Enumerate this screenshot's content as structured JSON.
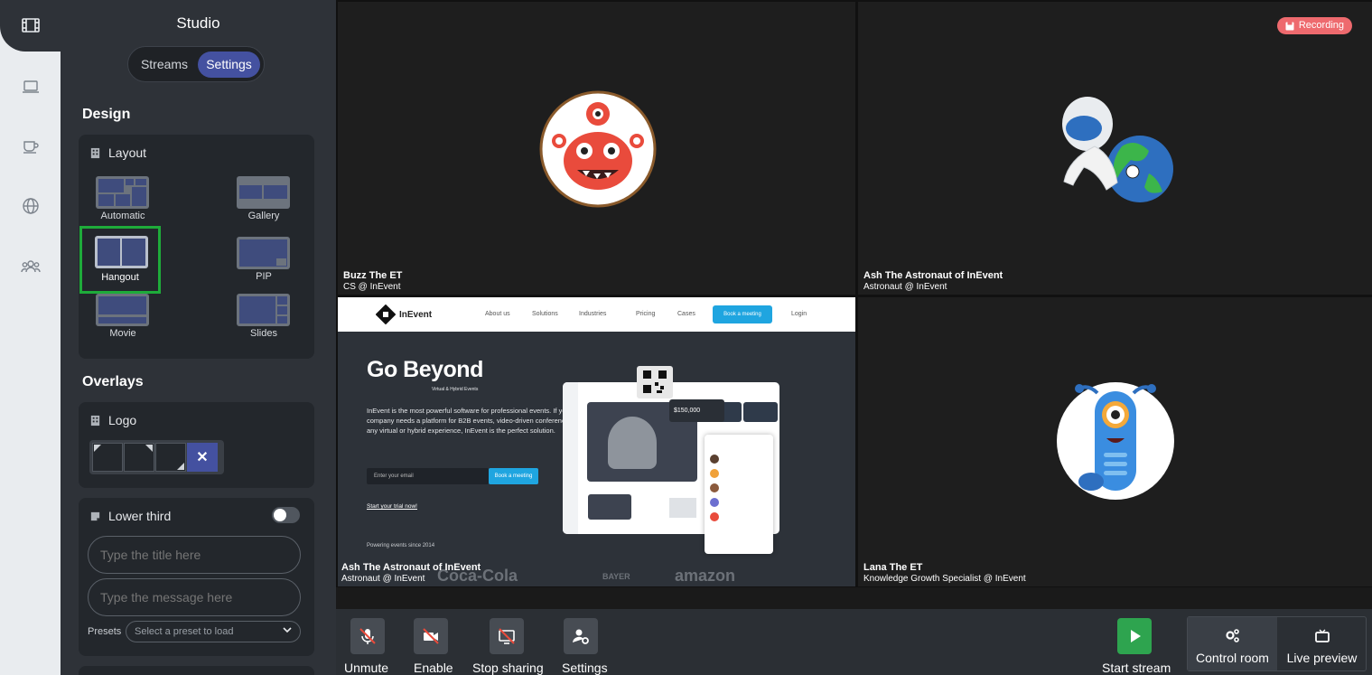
{
  "rail": {
    "items": [
      "studio-icon",
      "laptop-icon",
      "coffee-icon",
      "globe-icon",
      "people-icon"
    ]
  },
  "panel": {
    "title": "Studio",
    "tabs": [
      {
        "label": "Streams",
        "active": false
      },
      {
        "label": "Settings",
        "active": true
      }
    ],
    "design_heading": "Design",
    "layout": {
      "title": "Layout",
      "options": [
        {
          "label": "Automatic",
          "selected": false
        },
        {
          "label": "Gallery",
          "selected": false
        },
        {
          "label": "Hangout",
          "selected": true
        },
        {
          "label": "PIP",
          "selected": false
        },
        {
          "label": "Movie",
          "selected": false
        },
        {
          "label": "Slides",
          "selected": false
        }
      ]
    },
    "overlays_heading": "Overlays",
    "logo": {
      "title": "Logo",
      "clear_label": "✕"
    },
    "lower_third": {
      "title": "Lower third",
      "enabled": false,
      "title_placeholder": "Type the title here",
      "message_placeholder": "Type the message here",
      "presets_label": "Presets",
      "presets_value": "Select a preset to load"
    }
  },
  "stage": {
    "recording_label": "Recording",
    "tiles": [
      {
        "name": "Buzz The ET",
        "role": "CS @ InEvent"
      },
      {
        "name": "Ash The Astronaut of InEvent",
        "role": "Astronaut @ InEvent"
      },
      {
        "name": "Ash The Astronaut of InEvent",
        "role": "Astronaut @ InEvent"
      },
      {
        "name": "Lana The ET",
        "role": "Knowledge Growth Specialist @ InEvent"
      }
    ],
    "share": {
      "brand": "InEvent",
      "nav": [
        "About us",
        "Solutions",
        "Industries",
        "Pricing",
        "Cases"
      ],
      "book_label": "Book a meeting",
      "login_label": "Login",
      "headline": "Go Beyond",
      "subheadline": "Virtual & Hybrid Events",
      "paragraph": "InEvent is the most powerful software for professional events. If your company needs a platform for B2B events, video-driven conferences, or any virtual or hybrid experience, InEvent is the perfect solution.",
      "email_placeholder": "Enter your email",
      "cta_label": "Book a meeting",
      "trial_label": "Start your trial now!",
      "powering": "Powering events since 2014",
      "price": "$150,000",
      "logos": [
        "Coca-Cola",
        "BAYER",
        "amazon"
      ]
    }
  },
  "controls": {
    "unmute": "Unmute",
    "enable": "Enable",
    "stop_sharing": "Stop sharing",
    "settings": "Settings",
    "start_stream": "Start stream",
    "control_room": "Control room",
    "live_preview": "Live preview"
  },
  "colors": {
    "accent": "#4451a0",
    "recording": "#ee6a6e",
    "start": "#2ea44f",
    "selected_outline": "#1eab3a"
  }
}
